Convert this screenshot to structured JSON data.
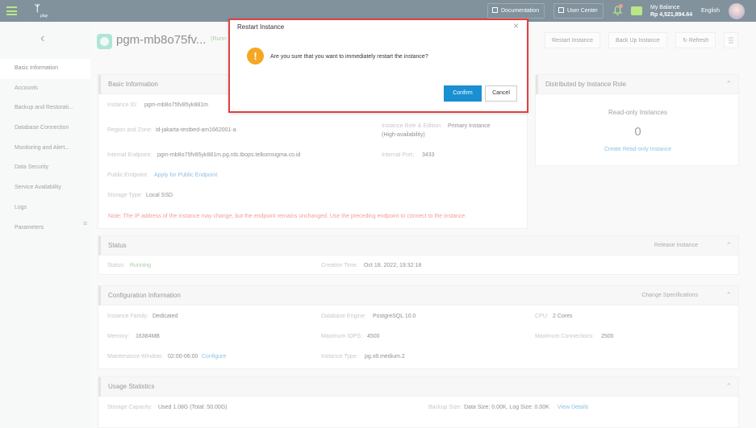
{
  "topbar": {
    "logo_text": "play",
    "documentation": "Documentation",
    "user_center": "User Center",
    "balance_label": "My Balance",
    "balance_amount": "Rp 4,521,894.64",
    "language": "English"
  },
  "sidebar": {
    "items": [
      {
        "label": "Basic Information"
      },
      {
        "label": "Accounts"
      },
      {
        "label": "Backup and Restorati..."
      },
      {
        "label": "Database Connection"
      },
      {
        "label": "Monitoring and Alert..."
      },
      {
        "label": "Data Security"
      },
      {
        "label": "Service Availability"
      },
      {
        "label": "Logs"
      },
      {
        "label": "Parameters"
      }
    ]
  },
  "header": {
    "title": "pgm-mb8o75fv...",
    "state": "(Runn",
    "restart": "Restart Instance",
    "backup": "Back Up Instance",
    "refresh": "Refresh"
  },
  "basic_info": {
    "title": "Basic Information",
    "instance_id_label": "Instance ID:",
    "instance_id": "pgm-mb8o75fv85yk881m",
    "region_label": "Region and Zone:",
    "region": "id-jakarta-testbed-am1662001-a",
    "role_label": "Instance Role & Edition:",
    "role": "Primary Instance",
    "role2": "(High-availability)",
    "endpoint_label": "Internal Endpoint:",
    "endpoint": "pgm-mb8o75fv85yk881m.pg.rds.tbops.telkomsigma.co.id",
    "port_label": "Internal Port:",
    "port": "3433",
    "public_label": "Public Endpoint:",
    "public_link": "Apply for Public Endpoint",
    "storage_label": "Storage Type:",
    "storage": "Local SSD",
    "note": "Note: The IP address of the instance may change, but the endpoint remains unchanged. Use the preceding endpoint to connect to the instance."
  },
  "distributed": {
    "title": "Distributed by Instance Role",
    "readonly_title": "Read-only Instances",
    "readonly_count": "0",
    "create_link": "Create Read-only Instance"
  },
  "status": {
    "title": "Status",
    "release": "Release Instance",
    "status_label": "Status:",
    "status_value": "Running",
    "creation_label": "Creation Time:",
    "creation_value": "Oct 18, 2022, 19:32:18"
  },
  "config": {
    "title": "Configuration Information",
    "change": "Change Specifications",
    "family_label": "Instance Family:",
    "family": "Dedicated",
    "engine_label": "Database Engine:",
    "engine": "PostgreSQL 10.0",
    "cpu_label": "CPU:",
    "cpu": "2 Cores",
    "memory_label": "Memory:",
    "memory": "16384MB",
    "iops_label": "Maximum IOPS:",
    "iops": "4500",
    "conn_label": "Maximum Connections:",
    "conn": "2500",
    "maint_label": "Maintenance Window:",
    "maint": "02:00-06:00",
    "maint_link": "Configure",
    "type_label": "Instance Type:",
    "type": "pg.x8.medium.2"
  },
  "usage": {
    "title": "Usage Statistics",
    "storage_label": "Storage Capacity:",
    "storage": "Used 1.08G  (Total: 50.00G)",
    "backup_label": "Backup Size:",
    "backup": "Data Size: 0.00K, Log Size: 0.00K",
    "view_link": "View Details"
  },
  "dialog": {
    "title": "Restart Instance",
    "message": "Are you sure that you want to immediately restart the instance?",
    "confirm": "Confirm",
    "cancel": "Cancel"
  },
  "colors": {
    "topbar": "#1b3a4e",
    "accent_green": "#7ed321",
    "primary_blue": "#1a8fd1",
    "warning": "#f5a623",
    "danger": "#e84c3d"
  }
}
